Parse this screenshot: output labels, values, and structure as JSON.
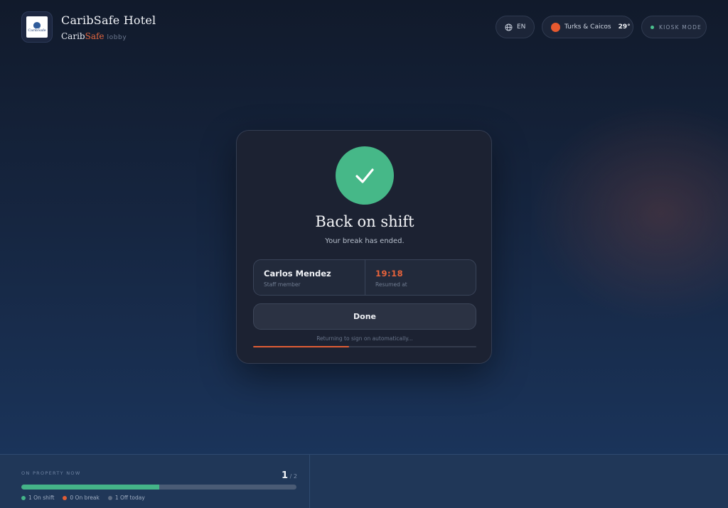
{
  "header": {
    "title": "CaribSafe Hotel",
    "subtitle_part1": "Carib",
    "subtitle_part2": "Safe",
    "location_tag": "lobby",
    "logo_text": "CaribSafe",
    "language": "EN",
    "weather": {
      "place": "Turks & Caicos",
      "temp": "29°",
      "icon": "sun-icon"
    },
    "kiosk_label": "KIOSK MODE"
  },
  "card": {
    "title": "Back on shift",
    "subtitle": "Your break has ended.",
    "staff_name": "Carlos Mendez",
    "staff_label": "Staff member",
    "resumed_time": "19:18",
    "resumed_label": "Resumed at",
    "done_label": "Done",
    "returning_text": "Returning to sign on automatically...",
    "progress": 0.43
  },
  "property": {
    "label": "ON PROPERTY NOW",
    "count": "1",
    "total": "2",
    "fraction_on_shift": 0.5,
    "legend": [
      {
        "text": "1 On shift",
        "color": "#44b488"
      },
      {
        "text": "0 On break",
        "color": "#e15d35"
      },
      {
        "text": "1 Off today",
        "color": "#5c6b82"
      }
    ]
  },
  "colors": {
    "accent": "#e15d35",
    "success": "#46b888"
  }
}
